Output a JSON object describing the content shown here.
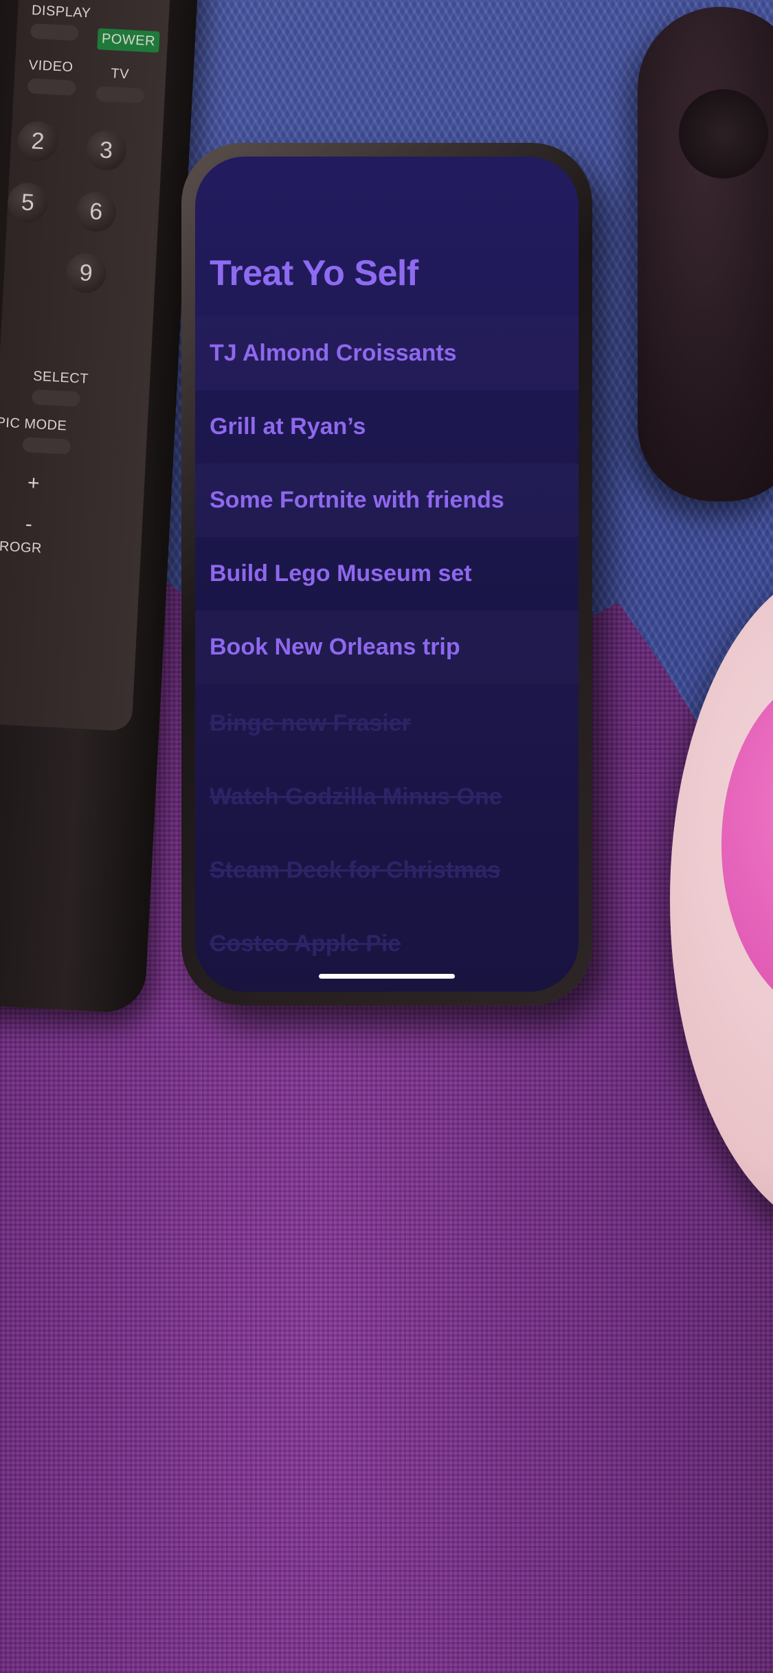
{
  "app": {
    "title": "Treat Yo Self"
  },
  "todo": {
    "active_items": [
      "TJ Almond Croissants",
      "Grill at Ryan’s",
      "Some Fortnite with friends",
      "Build Lego Museum set",
      "Book New Orleans trip"
    ],
    "completed_items": [
      "Binge new Frasier",
      "Watch Godzilla Minus One",
      "Steam Deck for Christmas",
      "Costco Apple Pie"
    ]
  },
  "remote": {
    "labels": {
      "display": "DISPLAY",
      "power": "POWER",
      "video": "VIDEO",
      "tv": "TV",
      "select": "SELECT",
      "pic_mode": "PIC MODE",
      "plus": "+",
      "minus": "-",
      "progr": "PROGR"
    },
    "keys": [
      "2",
      "3",
      "5",
      "6",
      "9"
    ]
  },
  "colors": {
    "accent": "#8e6bf1",
    "screen_bg": "#201a55",
    "completed_text": "#2c2466",
    "home_indicator": "#ffffff"
  }
}
